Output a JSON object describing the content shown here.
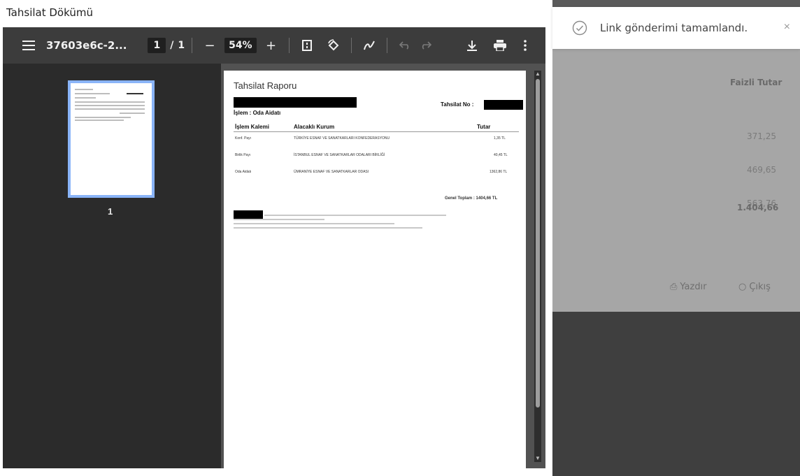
{
  "modal": {
    "title": "Tahsilat Dökümü"
  },
  "toolbar": {
    "menu_icon": "menu-icon",
    "filename": "37603e6c-2...",
    "page_current": "1",
    "page_separator": "/",
    "page_total": "1",
    "zoom_out": "−",
    "zoom_value": "54%",
    "zoom_in": "+"
  },
  "thumbnails": {
    "page_number": "1"
  },
  "document": {
    "title": "Tahsilat Raporu",
    "islem": "İşlem : Oda Aidatı",
    "tahsilat_no_label": "Tahsilat No :",
    "columns": [
      "İşlem Kalemi",
      "Alacaklı Kurum",
      "Tutar"
    ],
    "rows": [
      {
        "kalem": "Konf. Payı",
        "kurum": "TÜRKİYE ESNAF VE SANATKARLARI KONFEDERASYONU",
        "tutar": "1,35 TL"
      },
      {
        "kalem": "Birlik Payı",
        "kurum": "İSTANBUL ESNAF VE SANATKARLAR ODALARI BİRLİĞİ",
        "tutar": "40,45 TL"
      },
      {
        "kalem": "Oda Aidatı",
        "kurum": "ÜMRANİYE ESNAF VE SANATKARLAR ODASI",
        "tutar": "1362,86 TL"
      }
    ],
    "genel_toplam": "Genel Toplam : 1404,66 TL"
  },
  "background": {
    "faizli_tutar": "Faizli Tutar",
    "amounts": [
      "371,25",
      "469,65",
      "563,76"
    ],
    "total": "1.404,66",
    "yazdir": "Yazdır",
    "cikis": "Çıkış"
  },
  "toast": {
    "message": "Link gönderimi tamamlandı.",
    "close": "×"
  }
}
